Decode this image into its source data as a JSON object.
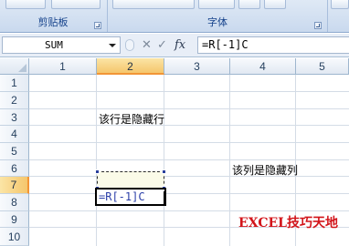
{
  "ribbon": {
    "groups": [
      {
        "label": "剪贴板"
      },
      {
        "label": "字体"
      }
    ]
  },
  "formula_bar": {
    "name_box": "SUM",
    "formula": "=R[-1]C"
  },
  "sheet": {
    "columns": [
      "1",
      "2",
      "3",
      "4",
      "5"
    ],
    "active_column": "2",
    "rows": [
      "1",
      "2",
      "3",
      "4",
      "5",
      "6",
      "7",
      "8",
      "9",
      "10"
    ],
    "active_row": "7",
    "cells": [
      {
        "text": "该行是隐藏行"
      },
      {
        "text": "该列是隐藏列"
      }
    ],
    "editing_cell_text": "=R[-1]C"
  },
  "watermark": "EXCEL技巧天地",
  "colors": {
    "ribbon_label": "#15428b",
    "active_header": "#f5c66c",
    "edit_text": "#2b3fa8",
    "watermark": "#d2141a"
  }
}
